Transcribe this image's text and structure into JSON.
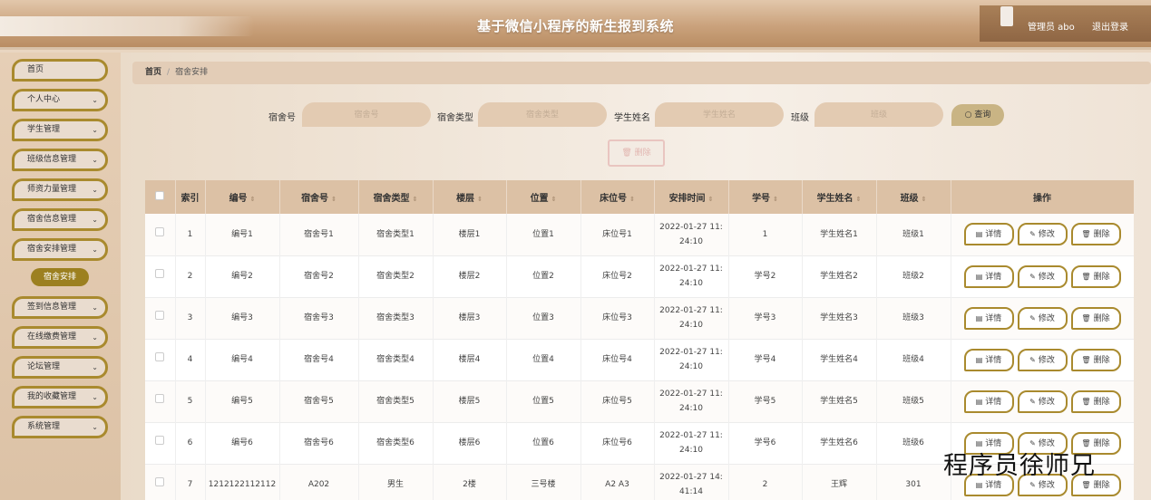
{
  "header": {
    "title": "基于微信小程序的新生报到系统",
    "user_info": "管理员 abo",
    "logout": "退出登录"
  },
  "sidebar": {
    "items": [
      {
        "label": "首页",
        "chevron": false
      },
      {
        "label": "个人中心",
        "chevron": true
      },
      {
        "label": "学生管理",
        "chevron": true
      },
      {
        "label": "班级信息管理",
        "chevron": true
      },
      {
        "label": "师资力量管理",
        "chevron": true
      },
      {
        "label": "宿舍信息管理",
        "chevron": true
      },
      {
        "label": "宿舍安排管理",
        "chevron": true
      },
      {
        "label": "签到信息管理",
        "chevron": true
      },
      {
        "label": "在线缴费管理",
        "chevron": true
      },
      {
        "label": "论坛管理",
        "chevron": true
      },
      {
        "label": "我的收藏管理",
        "chevron": true
      },
      {
        "label": "系统管理",
        "chevron": true
      }
    ],
    "active_subitem": "宿舍安排"
  },
  "breadcrumb": {
    "home": "首页",
    "separator": "/",
    "current": "宿舍安排"
  },
  "search": {
    "fields": [
      {
        "label": "宿舍号",
        "placeholder": "宿舍号"
      },
      {
        "label": "宿舍类型",
        "placeholder": "宿舍类型"
      },
      {
        "label": "学生姓名",
        "placeholder": "学生姓名"
      },
      {
        "label": "班级",
        "placeholder": "班级"
      }
    ],
    "query_label": "查询"
  },
  "toolbar": {
    "delete_label": "删除"
  },
  "table": {
    "columns": [
      "索引",
      "编号",
      "宿舍号",
      "宿舍类型",
      "楼层",
      "位置",
      "床位号",
      "安排时间",
      "学号",
      "学生姓名",
      "班级",
      "操作"
    ],
    "sortable": [
      false,
      true,
      true,
      true,
      true,
      true,
      true,
      true,
      true,
      true,
      true,
      false
    ],
    "actions": {
      "detail": "详情",
      "edit": "修改",
      "delete": "删除"
    },
    "rows": [
      {
        "index": "1",
        "code": "编号1",
        "dorm_no": "宿舍号1",
        "dorm_type": "宿舍类型1",
        "floor": "楼层1",
        "location": "位置1",
        "bed_no": "床位号1",
        "time_date": "2022-01-27 11:",
        "time_clock": "24:10",
        "student_no": "1",
        "student_name": "学生姓名1",
        "class_name": "班级1"
      },
      {
        "index": "2",
        "code": "编号2",
        "dorm_no": "宿舍号2",
        "dorm_type": "宿舍类型2",
        "floor": "楼层2",
        "location": "位置2",
        "bed_no": "床位号2",
        "time_date": "2022-01-27 11:",
        "time_clock": "24:10",
        "student_no": "学号2",
        "student_name": "学生姓名2",
        "class_name": "班级2"
      },
      {
        "index": "3",
        "code": "编号3",
        "dorm_no": "宿舍号3",
        "dorm_type": "宿舍类型3",
        "floor": "楼层3",
        "location": "位置3",
        "bed_no": "床位号3",
        "time_date": "2022-01-27 11:",
        "time_clock": "24:10",
        "student_no": "学号3",
        "student_name": "学生姓名3",
        "class_name": "班级3"
      },
      {
        "index": "4",
        "code": "编号4",
        "dorm_no": "宿舍号4",
        "dorm_type": "宿舍类型4",
        "floor": "楼层4",
        "location": "位置4",
        "bed_no": "床位号4",
        "time_date": "2022-01-27 11:",
        "time_clock": "24:10",
        "student_no": "学号4",
        "student_name": "学生姓名4",
        "class_name": "班级4"
      },
      {
        "index": "5",
        "code": "编号5",
        "dorm_no": "宿舍号5",
        "dorm_type": "宿舍类型5",
        "floor": "楼层5",
        "location": "位置5",
        "bed_no": "床位号5",
        "time_date": "2022-01-27 11:",
        "time_clock": "24:10",
        "student_no": "学号5",
        "student_name": "学生姓名5",
        "class_name": "班级5"
      },
      {
        "index": "6",
        "code": "编号6",
        "dorm_no": "宿舍号6",
        "dorm_type": "宿舍类型6",
        "floor": "楼层6",
        "location": "位置6",
        "bed_no": "床位号6",
        "time_date": "2022-01-27 11:",
        "time_clock": "24:10",
        "student_no": "学号6",
        "student_name": "学生姓名6",
        "class_name": "班级6"
      },
      {
        "index": "7",
        "code": "1212122112112",
        "dorm_no": "A202",
        "dorm_type": "男生",
        "floor": "2楼",
        "location": "三号楼",
        "bed_no": "A2 A3",
        "time_date": "2022-01-27 14:",
        "time_clock": "41:14",
        "student_no": "2",
        "student_name": "王辉",
        "class_name": "301"
      }
    ]
  },
  "watermark": "程序员徐师兄",
  "colors": {
    "accent_border": "#a98a2e",
    "active_submenu": "#9c8020",
    "header_bg": "#caa27c",
    "table_header_bg": "#dcc1a5"
  }
}
